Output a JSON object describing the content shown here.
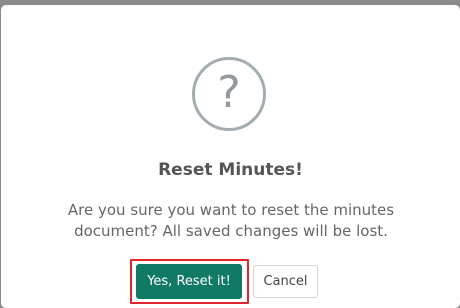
{
  "dialog": {
    "icon": "question-mark-icon",
    "icon_glyph": "?",
    "title": "Reset Minutes!",
    "message": "Are you sure you want to reset the minutes document? All saved changes will be lost.",
    "confirm_label": "Yes, Reset it!",
    "cancel_label": "Cancel"
  },
  "colors": {
    "confirm_button": "#117a65",
    "focus_outline": "#e2262c",
    "icon_border": "#a3acb1",
    "backdrop": "#8a8a8a"
  }
}
